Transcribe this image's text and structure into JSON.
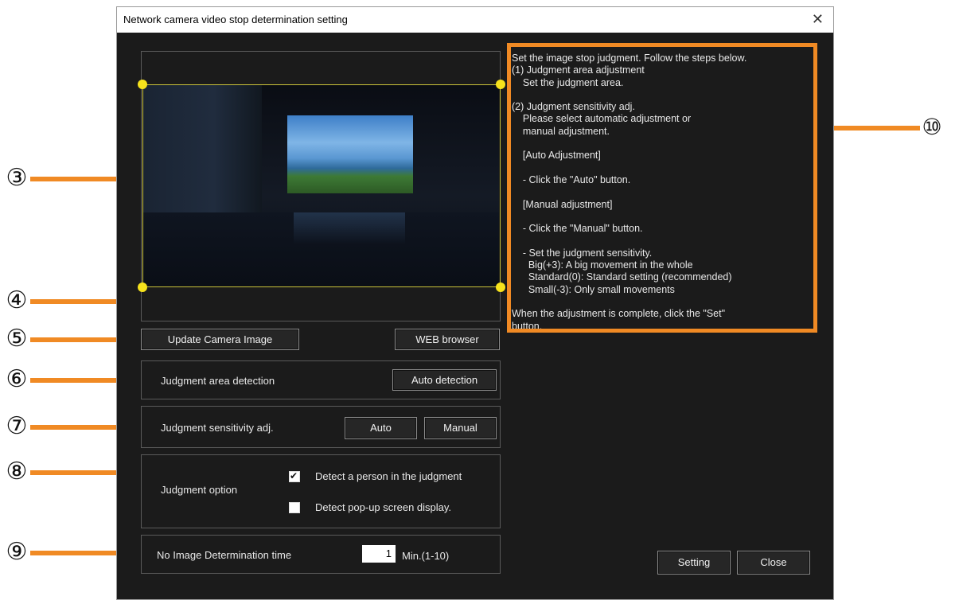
{
  "window": {
    "title": "Network camera video stop determination setting",
    "close_glyph": "✕"
  },
  "preview": {
    "update_button": "Update Camera Image",
    "web_button": "WEB browser"
  },
  "area_detection": {
    "label": "Judgment area detection",
    "auto_button": "Auto detection"
  },
  "sensitivity": {
    "label": "Judgment sensitivity adj.",
    "auto_button": "Auto",
    "manual_button": "Manual"
  },
  "option": {
    "label": "Judgment option",
    "person_label": "Detect a person in the judgment",
    "person_checked": true,
    "popup_label": "Detect pop-up screen display.",
    "popup_checked": false
  },
  "determination": {
    "label": "No Image Determination time",
    "value": "1",
    "unit": "Min.(1-10)"
  },
  "footer": {
    "setting_button": "Setting",
    "close_button": "Close"
  },
  "help_text": "Set the image stop judgment. Follow the steps below.\n(1) Judgment area adjustment\n    Set the judgment area.\n\n(2) Judgment sensitivity adj.\n    Please select automatic adjustment or\n    manual adjustment.\n\n    [Auto Adjustment]\n\n    - Click the \"Auto\" button.\n\n    [Manual adjustment]\n\n    - Click the \"Manual\" button.\n\n    - Set the judgment sensitivity.\n      Big(+3): A big movement in the whole\n      Standard(0): Standard setting (recommended)\n      Small(-3): Only small movements\n\nWhen the adjustment is complete, click the \"Set\"\nbutton.",
  "callouts": [
    "③",
    "④",
    "⑤",
    "⑥",
    "⑦",
    "⑧",
    "⑨",
    "⑩"
  ],
  "colors": {
    "callout": "#f08a24",
    "window_bg": "#1b1b1b",
    "handle": "#f6e21c",
    "judge_rect": "#c9c23a"
  }
}
